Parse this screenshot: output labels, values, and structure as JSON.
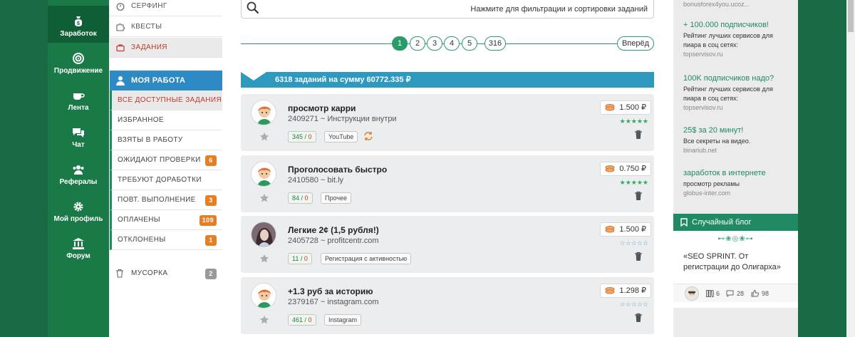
{
  "nav": {
    "items": [
      {
        "label": "Заработок",
        "icon": "money-bag-icon",
        "active": true
      },
      {
        "label": "Продвижение",
        "icon": "target-icon"
      },
      {
        "label": "Лента",
        "icon": "cup-icon"
      },
      {
        "label": "Чат",
        "icon": "chat-icon"
      },
      {
        "label": "Рефералы",
        "icon": "users-icon"
      },
      {
        "label": "Мой профиль",
        "icon": "gear-icon"
      },
      {
        "label": "Форум",
        "icon": "bank-icon"
      }
    ]
  },
  "submenu": {
    "top": [
      "СЕРФИНГ",
      "КВЕСТЫ",
      "ЗАДАНИЯ"
    ],
    "mywork_label": "МОЯ РАБОТА",
    "items": [
      {
        "label": "ВСЕ ДОСТУПНЫЕ ЗАДАНИЯ",
        "badge": ""
      },
      {
        "label": "ИЗБРАННОЕ",
        "badge": ""
      },
      {
        "label": "ВЗЯТЫ В РАБОТУ",
        "badge": ""
      },
      {
        "label": "ОЖИДАЮТ ПРОВЕРКИ",
        "badge": "6"
      },
      {
        "label": "ТРЕБУЮТ ДОРАБОТКИ",
        "badge": ""
      },
      {
        "label": "ПОВТ. ВЫПОЛНЕНИЕ",
        "badge": "3"
      },
      {
        "label": "ОПЛАЧЕНЫ",
        "badge": "109"
      },
      {
        "label": "ОТКЛОНЕНЫ",
        "badge": "1"
      }
    ],
    "trash_label": "МУСОРКА",
    "trash_badge": "2"
  },
  "search": {
    "placeholder": "Нажмите для фильтрации и сортировки заданий"
  },
  "pager": {
    "pages": [
      "1",
      "2",
      "3",
      "4",
      "5",
      "316"
    ],
    "current": "1",
    "next_label": "Вперёд"
  },
  "summary": {
    "count_text": "6318 заданий на сумму",
    "amount": "60772.335 ₽"
  },
  "tasks": [
    {
      "title": "просмотр карри",
      "id": "2409271",
      "sep": "~",
      "source": "Инструкции внутри",
      "done": "345",
      "rejected": "0",
      "tag": "YouTube",
      "repeat": true,
      "price": "1.500 ₽",
      "stars": "★★★★★",
      "rated": true,
      "avatar": "redhead-avatar"
    },
    {
      "title": "Проголосовать быстро",
      "id": "2410580",
      "sep": "~",
      "source": "bit.ly",
      "done": "84",
      "rejected": "0",
      "tag": "Прочее",
      "repeat": false,
      "price": "0.750 ₽",
      "stars": "★★★★★",
      "rated": true,
      "avatar": "redhead-avatar"
    },
    {
      "title": "Легкие 2¢ (1,5 рубля!)",
      "id": "2405728",
      "sep": "~",
      "source": "profitcentr.com",
      "done": "11",
      "rejected": "0",
      "tag": "Регистрация с активностью",
      "repeat": false,
      "price": "1.500 ₽",
      "stars": "☆☆☆☆☆",
      "rated": false,
      "avatar": "photo-avatar"
    },
    {
      "title": "+1.3 руб за историю",
      "id": "2379167",
      "sep": "~",
      "source": "instagram.com",
      "done": "461",
      "rejected": "0",
      "tag": "Instagram",
      "repeat": false,
      "price": "1.298 ₽",
      "stars": "☆☆☆☆☆",
      "rated": false,
      "avatar": "redhead-avatar"
    }
  ],
  "ads": [
    {
      "head": "",
      "desc": "",
      "url": "bonusforex4you.ucoz..."
    },
    {
      "head": "+ 100.000 подписчиков!",
      "desc": "Рейтинг лучших сервисов для пиара в соц сетях:",
      "url": "topservisov.ru"
    },
    {
      "head": "100K подписчиков надо?",
      "desc": "Рейтинг лучших сервисов для пиара в соц сетях:",
      "url": "topservisov.ru"
    },
    {
      "head": "25$ за 20 минут!",
      "desc": "Все секреты на видео.",
      "url": "binariub.net"
    },
    {
      "head": "заработок в интернете",
      "desc": "просмотр рекламы",
      "url": "globus-inter.com"
    }
  ],
  "blog": {
    "header": "Случайный блог",
    "ornament": "⊷❀◎❀⊶",
    "title": "«SEO SPRINT. От регистрации до Олигарха»",
    "posts": "6",
    "comments": "28",
    "likes": "98"
  },
  "colors": {
    "nav_bg": "#197a47",
    "accent_green": "#1f8a63",
    "bar_blue": "#2d99bf",
    "badge_orange": "#e67e22",
    "active_red": "#c0392b"
  }
}
